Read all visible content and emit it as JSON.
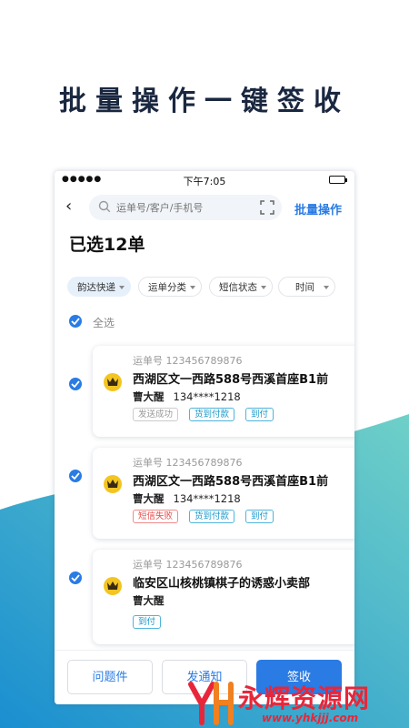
{
  "headline": "批量操作一键签收",
  "status_bar": {
    "signal": "●●●●●",
    "time": "下午7:05"
  },
  "search": {
    "placeholder": "运单号/客户/手机号"
  },
  "batch_action": "批量操作",
  "selected_count_text": "已选12单",
  "filters": [
    {
      "label": "韵达快递",
      "active": true
    },
    {
      "label": "运单分类",
      "active": false
    },
    {
      "label": "短信状态",
      "active": false
    },
    {
      "label": "时间",
      "active": false
    }
  ],
  "select_all": {
    "label": "全选",
    "checked": true
  },
  "orders": [
    {
      "checked": true,
      "waybill": "运单号 123456789876",
      "address": "西湖区文一西路588号西溪首座B1前",
      "name": "曹大醒",
      "phone": "134****1218",
      "tags": [
        {
          "text": "发送成功",
          "style": "grey"
        },
        {
          "text": "货到付款",
          "style": "teal"
        },
        {
          "text": "到付",
          "style": "teal"
        }
      ]
    },
    {
      "checked": true,
      "waybill": "运单号 123456789876",
      "address": "西湖区文一西路588号西溪首座B1前",
      "name": "曹大醒",
      "phone": "134****1218",
      "tags": [
        {
          "text": "短信失败",
          "style": "red"
        },
        {
          "text": "货到付款",
          "style": "teal"
        },
        {
          "text": "到付",
          "style": "teal"
        }
      ]
    },
    {
      "checked": true,
      "waybill": "运单号 123456789876",
      "address": "临安区山核桃镇棋子的诱惑小卖部",
      "name": "曹大醒",
      "phone": "",
      "tags": [
        {
          "text": "到付",
          "style": "teal"
        }
      ]
    }
  ],
  "bottom_actions": {
    "problem": "问题件",
    "notify": "发通知",
    "sign": "签收"
  },
  "watermark": {
    "text": "永辉资源网",
    "url": "www.yhkjjj.com"
  },
  "colors": {
    "accent": "#2a7be4",
    "teal_tag": "#1a98c8",
    "red_tag": "#e64a4a",
    "brand_yellow": "#f3c522"
  }
}
